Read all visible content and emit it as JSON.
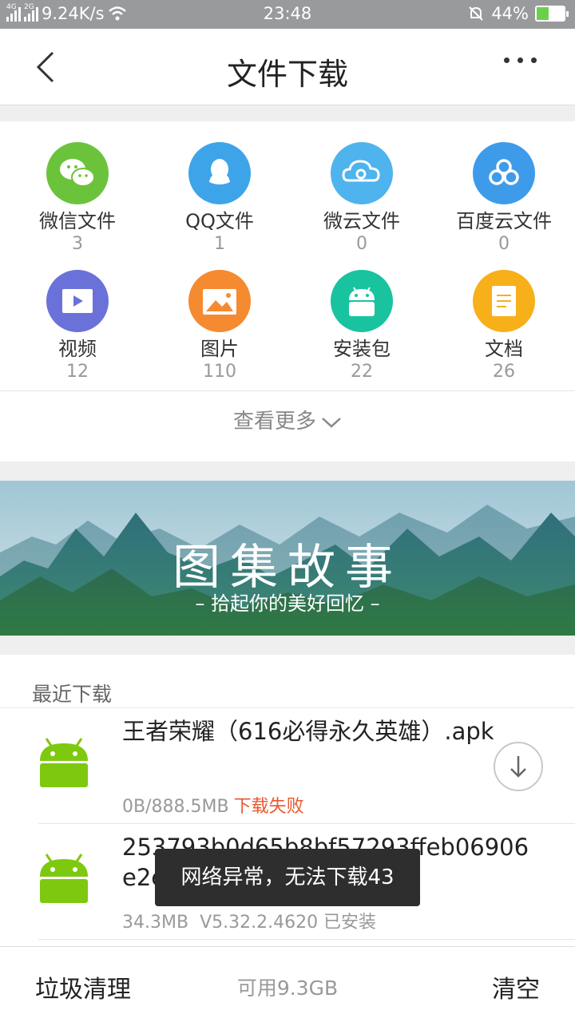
{
  "status_bar": {
    "sim1": "4G",
    "sim2": "2G",
    "speed": "9.24K/s",
    "time": "23:48",
    "battery": "44%",
    "battery_level": 0.44
  },
  "header": {
    "title": "文件下载",
    "back_icon": "chevron-left-icon",
    "more_icon": "more-dots-icon"
  },
  "categories": [
    {
      "name": "微信文件",
      "count": "3",
      "icon": "wechat-icon",
      "color": "#6bc33b"
    },
    {
      "name": "QQ文件",
      "count": "1",
      "icon": "qq-icon",
      "color": "#3ea4ea"
    },
    {
      "name": "微云文件",
      "count": "0",
      "icon": "weiyun-icon",
      "color": "#4fb3ee"
    },
    {
      "name": "百度云文件",
      "count": "0",
      "icon": "baidu-cloud-icon",
      "color": "#3d9bea"
    },
    {
      "name": "视频",
      "count": "12",
      "icon": "video-icon",
      "color": "#6a72d9"
    },
    {
      "name": "图片",
      "count": "110",
      "icon": "image-icon",
      "color": "#f58a30"
    },
    {
      "name": "安装包",
      "count": "22",
      "icon": "android-icon",
      "color": "#19c3a0"
    },
    {
      "name": "文档",
      "count": "26",
      "icon": "document-icon",
      "color": "#f7b019"
    }
  ],
  "see_more": "查看更多",
  "banner": {
    "title": "图集故事",
    "subtitle": "– 拾起你的美好回忆 –"
  },
  "recent": {
    "label": "最近下载",
    "items": [
      {
        "name": "王者荣耀（616必得永久英雄）.apk",
        "size": "0B/888.5MB",
        "status": "下载失败"
      },
      {
        "name": "253793b0d65b8bf57293ffeb06906e2e.apk",
        "size": "34.3MB",
        "version": "V5.32.2.4620 已安装"
      }
    ]
  },
  "toast": "网络异常，无法下载43",
  "footer": {
    "clean": "垃圾清理",
    "available": "可用9.3GB",
    "clear": "清空"
  }
}
